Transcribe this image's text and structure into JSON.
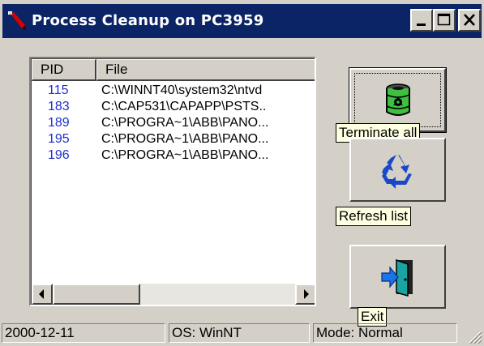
{
  "window": {
    "title": "Process Cleanup on PC3959",
    "title_bar_color": "#0a2466"
  },
  "title_buttons": [
    "minimize-icon",
    "maximize-icon",
    "close-icon"
  ],
  "list": {
    "columns": [
      "PID",
      "File"
    ],
    "rows": [
      {
        "pid": "115",
        "file": "C:\\WINNT40\\system32\\ntvd"
      },
      {
        "pid": "183",
        "file": "C:\\CAP531\\CAPAPP\\PSTS.."
      },
      {
        "pid": "189",
        "file": "C:\\PROGRA~1\\ABB\\PANO..."
      },
      {
        "pid": "195",
        "file": "C:\\PROGRA~1\\ABB\\PANO..."
      },
      {
        "pid": "196",
        "file": "C:\\PROGRA~1\\ABB\\PANO..."
      }
    ],
    "pid_color": "#2030c8"
  },
  "buttons": {
    "terminate": {
      "icon": "toxic-barrel-icon",
      "tooltip": "Terminate all"
    },
    "refresh": {
      "icon": "recycle-icon",
      "tooltip": "Refresh list"
    },
    "exit": {
      "icon": "exit-door-icon",
      "tooltip": "Exit"
    }
  },
  "status": {
    "date": "2000-12-11",
    "os": "OS: WinNT",
    "mode": "Mode: Normal"
  }
}
